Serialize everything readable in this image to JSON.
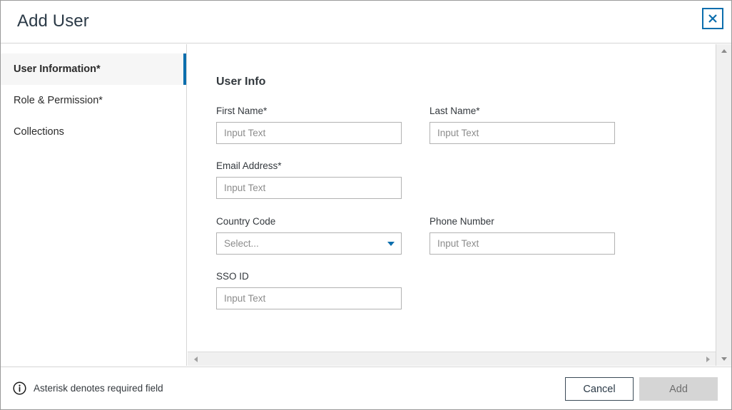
{
  "dialog": {
    "title": "Add User",
    "close_icon": "close-icon"
  },
  "sidebar": {
    "items": [
      {
        "label": "User Information*",
        "active": true
      },
      {
        "label": "Role & Permission*",
        "active": false
      },
      {
        "label": "Collections",
        "active": false
      }
    ]
  },
  "main": {
    "section_title": "User Info",
    "fields": [
      {
        "label": "First Name*",
        "placeholder": "Input Text",
        "value": "",
        "type": "text"
      },
      {
        "label": "Last Name*",
        "placeholder": "Input Text",
        "value": "",
        "type": "text"
      },
      {
        "label": "Email Address*",
        "placeholder": "Input Text",
        "value": "",
        "type": "text"
      },
      {
        "label": "Country Code",
        "placeholder": "Select...",
        "value": "Select...",
        "type": "select"
      },
      {
        "label": "Phone Number",
        "placeholder": "Input Text",
        "value": "",
        "type": "text"
      },
      {
        "label": "SSO ID",
        "placeholder": "Input Text",
        "value": "",
        "type": "text"
      }
    ]
  },
  "footer": {
    "info_icon": "info-circle-icon",
    "note": "Asterisk denotes required field",
    "cancel_label": "Cancel",
    "add_label": "Add"
  },
  "colors": {
    "accent": "#0b6ead",
    "title_text": "#2b3a47",
    "border": "#d6d6d6",
    "input_border": "#b2b2b2",
    "placeholder": "#8c8c8c",
    "disabled_button_bg": "#d5d5d5",
    "active_nav_bg": "#f6f6f6"
  }
}
